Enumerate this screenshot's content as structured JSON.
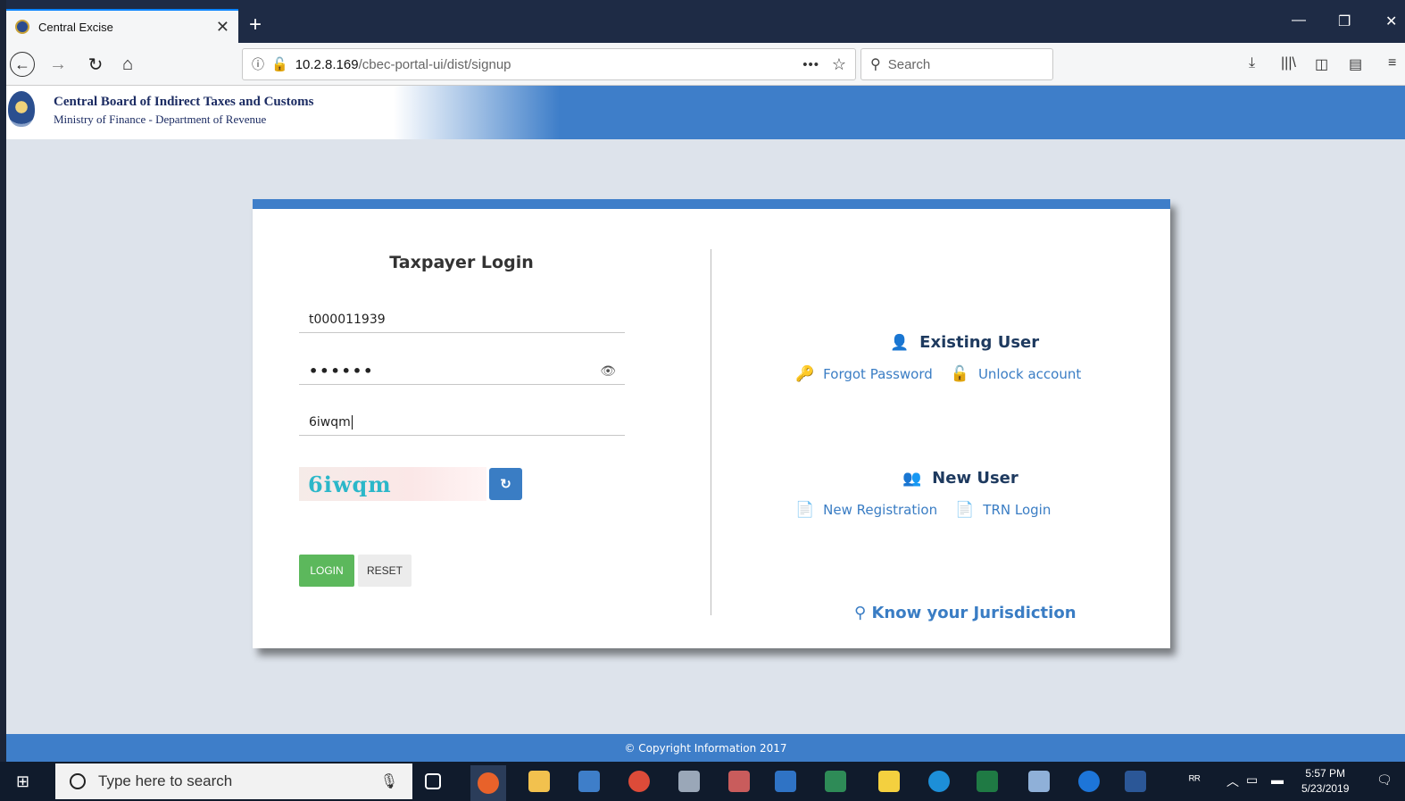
{
  "browser": {
    "tab_title": "Central Excise",
    "url_host": "10.2.8.169",
    "url_path": "/cbec-portal-ui/dist/signup",
    "search_placeholder": "Search"
  },
  "header": {
    "org_name": "Central Board of Indirect Taxes and Customs",
    "org_sub": "Ministry of Finance - Department of Revenue"
  },
  "login": {
    "title": "Taxpayer Login",
    "username_value": "t000011939",
    "password_value": "••••••",
    "captcha_input_value": "6iwqm",
    "captcha_image_text": "6iwqm",
    "login_label": "LOGIN",
    "reset_label": "RESET"
  },
  "existing_user": {
    "title": "Existing User",
    "links": [
      "Forgot Password",
      "Unlock account"
    ]
  },
  "new_user": {
    "title": "New User",
    "links": [
      "New Registration",
      "TRN Login"
    ]
  },
  "jurisdiction_label": "Know your Jurisdiction",
  "footer_text": "© Copyright Information 2017",
  "taskbar": {
    "search_placeholder": "Type here to search",
    "time": "5:57 PM",
    "date": "5/23/2019"
  },
  "colors": {
    "brand_blue": "#3e7ec9",
    "login_green": "#5cb85c",
    "link_orange": "#f0942b",
    "heading_navy": "#1e3a5f"
  },
  "icons": [
    "back-icon",
    "forward-icon",
    "reload-icon",
    "home-icon",
    "info-icon",
    "insecure-lock-icon",
    "bookmark-star-icon",
    "search-icon",
    "download-icon",
    "library-icon",
    "sidebar-icon",
    "reader-icon",
    "menu-icon",
    "eye-icon",
    "refresh-icon",
    "user-icon",
    "user-plus-icon",
    "key-icon",
    "unlock-icon",
    "document-icon",
    "map-marker-icon"
  ]
}
